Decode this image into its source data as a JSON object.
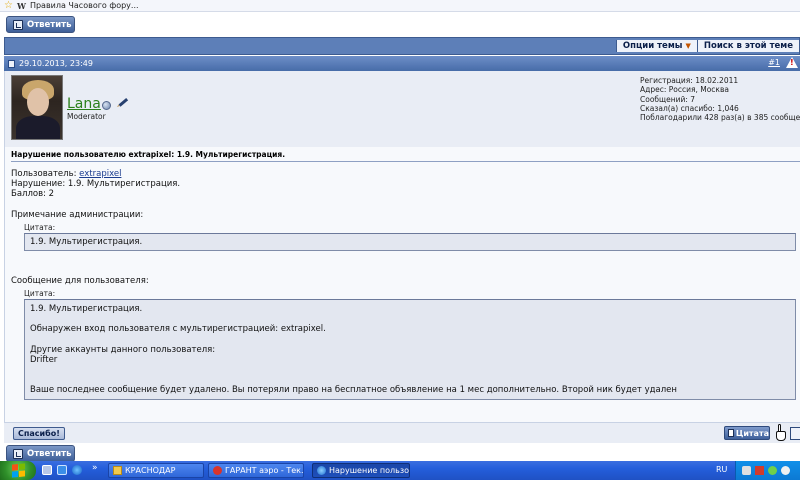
{
  "browser": {
    "favorite_label": "Правила Часового фору..."
  },
  "toolbar": {
    "reply_label": "Ответить"
  },
  "thread_tools": {
    "options_label": "Опции темы",
    "search_label": "Поиск в этой теме"
  },
  "post": {
    "date": "29.10.2013, 23:49",
    "number": "#1",
    "author": {
      "name": "Lana",
      "title": "Moderator",
      "stats": [
        "Регистрация: 18.02.2011",
        "Адрес: Россия, Москва",
        "Сообщений: 7",
        "Сказал(а) спасибо: 1,046",
        "Поблагодарили 428 раз(а) в 385 сообщени"
      ]
    },
    "title": "Нарушение пользователю extrapixel: 1.9. Мультирегистрация.",
    "user_prefix": "Пользователь: ",
    "user_link": "extrapixel",
    "violation": "Нарушение: 1.9. Мультирегистрация.",
    "points": "Баллов: 2",
    "admin_note_label": "Примечание администрации:",
    "quote_label": "Цитата:",
    "admin_quote": "1.9. Мультирегистрация.",
    "user_message_label": "Сообщение для пользователя:",
    "user_quote_lines": [
      "1.9. Мультирегистрация.",
      "Обнаружен вход пользователя с мультирегистрацией: extrapixel.",
      "Другие аккаунты данного пользователя:",
      "Drifter",
      "Ваше последнее сообщение будет удалено. Вы потеряли право на бесплатное объявление на 1 мес дополнительно. Второй ник будет удален"
    ],
    "thanks_label": "Спасибо!",
    "quote_button_label": "Цитата"
  },
  "taskbar": {
    "tasks": [
      {
        "label": "КРАСНОДАР",
        "icon": "folder-icon"
      },
      {
        "label": "ГАРАНТ аэро - Тек...",
        "icon": "app-icon"
      },
      {
        "label": "Нарушение пользо...",
        "icon": "ie-icon"
      }
    ],
    "language": "RU",
    "expand_label": "»"
  },
  "colors": {
    "header_blue": "#5d7fb8",
    "username_green": "#2a7f1a",
    "link_blue": "#1b3c8f",
    "taskbar_blue": "#245edb",
    "start_green": "#2f8f2a"
  }
}
